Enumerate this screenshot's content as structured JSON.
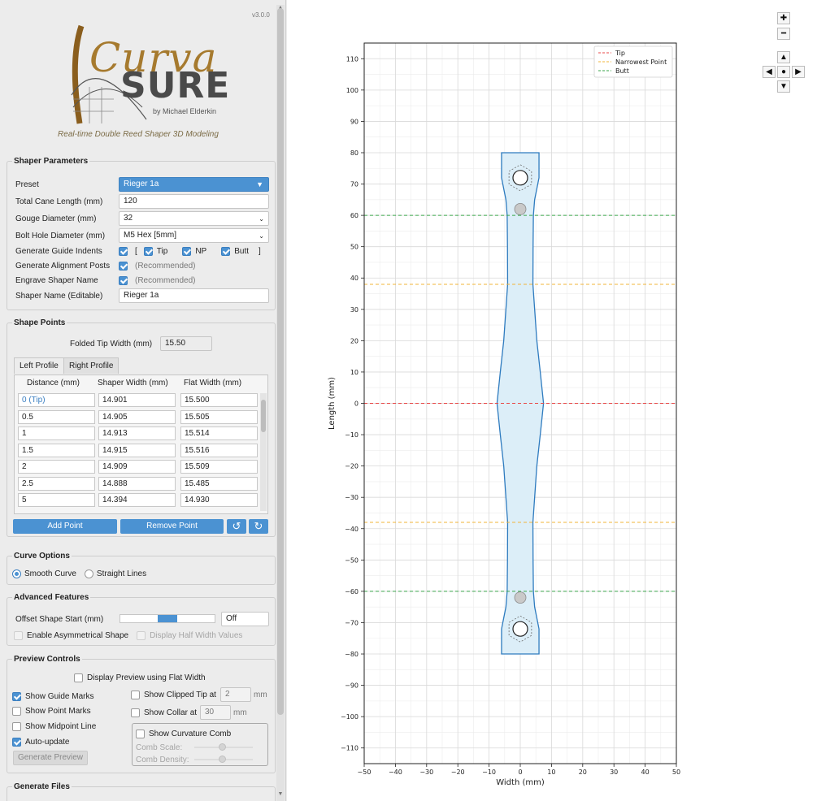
{
  "app": {
    "version": "v3.0.0",
    "logo_text_1": "Curva",
    "logo_text_2": "SURE",
    "logo_by": "by Michael Elderkin",
    "tagline": "Real-time Double Reed Shaper 3D Modeling"
  },
  "shaper_parameters": {
    "title": "Shaper Parameters",
    "preset_label": "Preset",
    "preset_value": "Rieger 1a",
    "total_length_label": "Total Cane Length (mm)",
    "total_length_value": "120",
    "gouge_label": "Gouge Diameter (mm)",
    "gouge_value": "32",
    "bolt_label": "Bolt Hole Diameter (mm)",
    "bolt_value": "M5 Hex [5mm]",
    "guide_label": "Generate Guide Indents",
    "bracket_open": "[",
    "bracket_close": "]",
    "tip_label": "Tip",
    "np_label": "NP",
    "butt_label": "Butt",
    "posts_label": "Generate Alignment Posts",
    "posts_note": "(Recommended)",
    "engrave_label": "Engrave Shaper Name",
    "engrave_note": "(Recommended)",
    "name_label": "Shaper Name (Editable)",
    "name_value": "Rieger 1a"
  },
  "shape_points": {
    "title": "Shape Points",
    "folded_tip_label": "Folded Tip Width (mm)",
    "folded_tip_value": "15.50",
    "tab_left": "Left Profile",
    "tab_right": "Right Profile",
    "headers": [
      "Distance (mm)",
      "Shaper Width (mm)",
      "Flat Width (mm)"
    ],
    "rows": [
      [
        "0 (Tip)",
        "14.901",
        "15.500"
      ],
      [
        "0.5",
        "14.905",
        "15.505"
      ],
      [
        "1",
        "14.913",
        "15.514"
      ],
      [
        "1.5",
        "14.915",
        "15.516"
      ],
      [
        "2",
        "14.909",
        "15.509"
      ],
      [
        "2.5",
        "14.888",
        "15.485"
      ],
      [
        "5",
        "14.394",
        "14.930"
      ]
    ],
    "add_label": "Add Point",
    "remove_label": "Remove Point"
  },
  "curve_options": {
    "title": "Curve Options",
    "smooth": "Smooth Curve",
    "straight": "Straight Lines"
  },
  "advanced": {
    "title": "Advanced Features",
    "offset_label": "Offset Shape Start (mm)",
    "offset_value": "Off",
    "offset_fraction": 0.5,
    "asym_label": "Enable Asymmetrical Shape",
    "half_label": "Display Half Width Values"
  },
  "preview": {
    "title": "Preview Controls",
    "flat_label": "Display Preview using Flat Width",
    "guide_marks": "Show Guide Marks",
    "point_marks": "Show Point Marks",
    "midpoint": "Show Midpoint Line",
    "auto_update": "Auto-update",
    "clipped_label": "Show Clipped Tip at",
    "clipped_value": "2",
    "collar_label": "Show Collar at",
    "collar_value": "30",
    "unit": "mm",
    "comb_label": "Show Curvature Comb",
    "comb_scale": "Comb Scale:",
    "comb_density": "Comb Density:",
    "generate_preview": "Generate Preview"
  },
  "generate_files": {
    "title": "Generate Files"
  },
  "colors": {
    "accent": "#4b92d2",
    "fill": "#dceef8",
    "outline": "#2e7bbf",
    "tip": "#e84a4a",
    "np": "#f2b43a",
    "butt": "#3aa64a"
  },
  "chart_data": {
    "type": "line",
    "xlabel": "Width (mm)",
    "ylabel": "Length (mm)",
    "xlim": [
      -50,
      50
    ],
    "ylim": [
      -115,
      115
    ],
    "xticks": [
      -50,
      -40,
      -30,
      -20,
      -10,
      0,
      10,
      20,
      30,
      40,
      50
    ],
    "yticks": [
      -110,
      -100,
      -90,
      -80,
      -70,
      -60,
      -50,
      -40,
      -30,
      -20,
      -10,
      0,
      10,
      20,
      30,
      40,
      50,
      60,
      70,
      80,
      90,
      100,
      110
    ],
    "grid": true,
    "legend_position": "top-right",
    "legend": [
      {
        "name": "Tip",
        "y": 0,
        "color": "#e84a4a"
      },
      {
        "name": "Narrowest Point",
        "y": 38,
        "color": "#f2b43a"
      },
      {
        "name": "Butt",
        "y": 60,
        "color": "#3aa64a"
      }
    ],
    "outline_half_width": [
      [
        80,
        6
      ],
      [
        72,
        6
      ],
      [
        65,
        4.6
      ],
      [
        60,
        4.2
      ],
      [
        50,
        4.1
      ],
      [
        38,
        4.05
      ],
      [
        20,
        5.3
      ],
      [
        10,
        6.4
      ],
      [
        0,
        7.45
      ],
      [
        -10,
        6.4
      ],
      [
        -20,
        5.3
      ],
      [
        -38,
        4.05
      ],
      [
        -50,
        4.1
      ],
      [
        -60,
        4.2
      ],
      [
        -65,
        4.6
      ],
      [
        -72,
        6
      ],
      [
        -80,
        6
      ]
    ],
    "bolt_holes": [
      72,
      -72
    ],
    "posts": [
      62,
      -62
    ]
  }
}
